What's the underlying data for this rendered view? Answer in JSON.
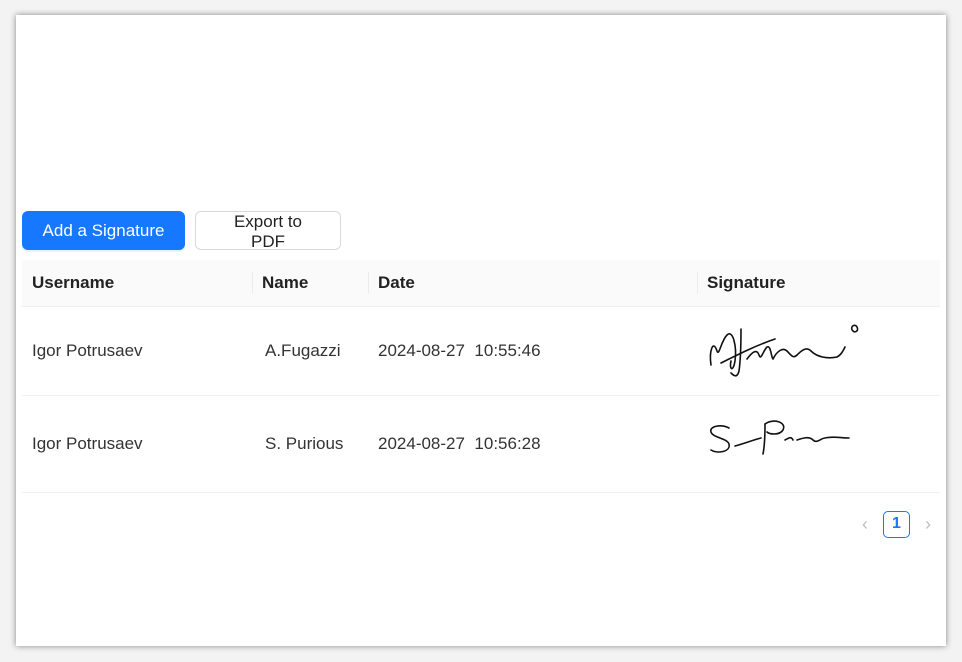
{
  "toolbar": {
    "add_label": "Add a Signature",
    "export_label": "Export to PDF"
  },
  "table": {
    "columns": [
      "Username",
      "Name",
      "Date",
      "Signature"
    ],
    "rows": [
      {
        "username": "Igor Potrusaev",
        "name": "A.Fugazzi",
        "date": "2024-08-27  10:55:46"
      },
      {
        "username": "Igor Potrusaev",
        "name": "S. Purious",
        "date": "2024-08-27  10:56:28"
      }
    ]
  },
  "pagination": {
    "current_page": "1"
  },
  "colors": {
    "primary": "#1677ff",
    "header_bg": "#fafafa",
    "border": "#f0f0f0"
  }
}
